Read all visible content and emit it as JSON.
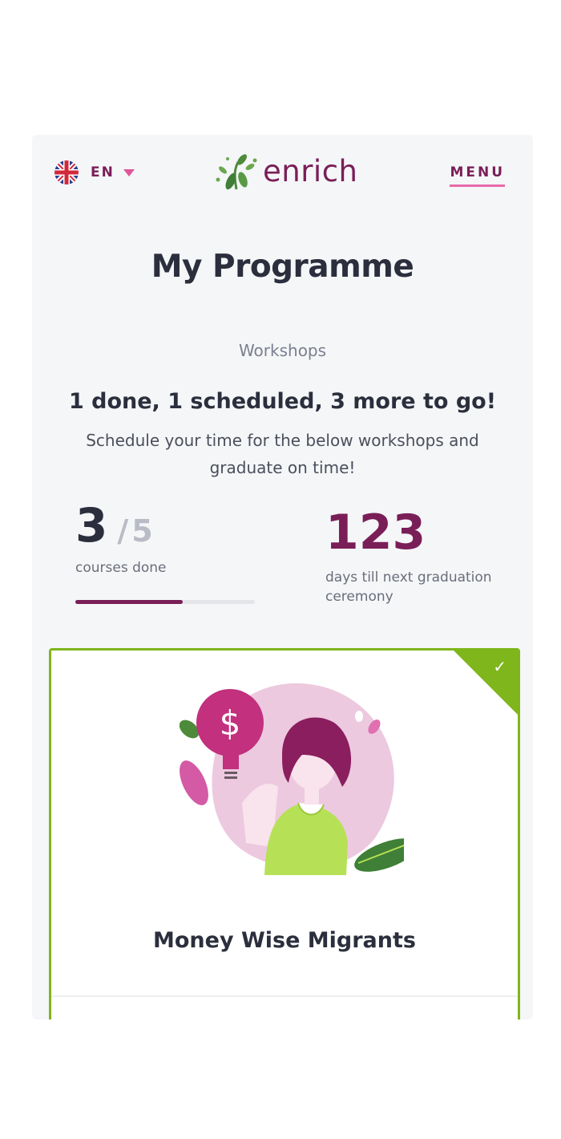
{
  "header": {
    "language_code": "EN",
    "logo_text": "enrich",
    "menu_label": "MENU"
  },
  "page": {
    "title": "My Programme",
    "section_label": "Workshops",
    "summary": "1 done, 1 scheduled, 3 more to go!",
    "subtitle": "Schedule your time for the below workshops and graduate on time!"
  },
  "stats": {
    "courses_done": "3",
    "courses_total": "5",
    "courses_separator": "/",
    "courses_label": "courses done",
    "courses_progress": 0.6,
    "days": "123",
    "days_label": "days till next graduation ceremony"
  },
  "workshop_card": {
    "title": "Money Wise Migrants",
    "completed": true,
    "status_icon": "check-icon",
    "illustration": "woman-holding-dollar-lightbulb"
  },
  "colors": {
    "brand": "#7a1e58",
    "accent_pink": "#e86aab",
    "completed_green": "#7fb61b",
    "text_dark": "#2b2f3d"
  }
}
